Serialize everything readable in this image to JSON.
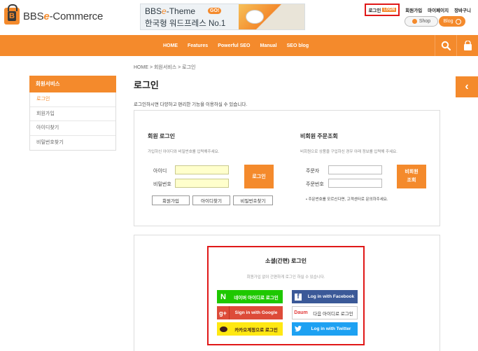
{
  "logo": {
    "text_prefix": "BBS",
    "text_accent": "e",
    "text_suffix": "-Commerce",
    "badge": "B"
  },
  "banner": {
    "line1_prefix": "BBS",
    "line1_accent": "e",
    "line1_suffix": "-Theme",
    "go_badge": "GO!",
    "line2": "한국형 워드프레스 No.1"
  },
  "top_links": [
    {
      "label": "로그인"
    },
    {
      "label": "회원가입"
    },
    {
      "label": "마이페이지"
    },
    {
      "label": "장바구니"
    }
  ],
  "login_tag": "LOGIN",
  "shop_button": "Shop",
  "blog_button": "Blog",
  "nav": {
    "items": [
      "HOME",
      "Features",
      "Powerful SEO",
      "Manual",
      "SEO blog"
    ]
  },
  "sidebar": {
    "title": "회원서비스",
    "items": [
      {
        "label": "로그인",
        "active": true
      },
      {
        "label": "회원가입",
        "active": false
      },
      {
        "label": "아이디찾기",
        "active": false
      },
      {
        "label": "비밀번호찾기",
        "active": false
      }
    ]
  },
  "breadcrumb": "HOME  >  회원서비스  >  로그인",
  "page_title": "로그인",
  "page_desc": "로그인하시면 다양하고 편리한 기능을 이용하실 수 있습니다.",
  "member_login": {
    "title": "회원 로그인",
    "desc": "가입하신 아이디와 비밀번호를 입력해주세요.",
    "id_label": "아이디",
    "pw_label": "비밀번호",
    "id_value": "",
    "pw_value": "",
    "login_button": "로그인",
    "join_button": "회원가입",
    "find_id_button": "아이디찾기",
    "find_pw_button": "비밀번호찾기"
  },
  "guest_order": {
    "title": "비회원 주문조회",
    "desc": "비회원으로 상품을 구입하신 경우 아래 정보를 입력해 주세요.",
    "orderer_label": "주문자",
    "order_no_label": "주문번호",
    "lookup_button_line1": "비회원",
    "lookup_button_line2": "조회",
    "note": "주문번호를 모르신다면, 고객센터로 문의하주세요."
  },
  "social": {
    "title": "소셜(간편) 로그인",
    "desc": "회원가입 없이 간편하게 로그인 하실 수 있습니다.",
    "buttons": [
      {
        "label": "네이버 아이디로 로그인",
        "icon": "N",
        "color": "#1ec800"
      },
      {
        "label": "Log in with Facebook",
        "icon": "f",
        "color": "#3b5998"
      },
      {
        "label": "Sign in with Google",
        "icon": "g+",
        "color": "#dd4b39"
      },
      {
        "label": "다음 아이디로 로그인",
        "icon": "Daum",
        "color": "#ffffff"
      },
      {
        "label": "카카오계정으로 로그인",
        "icon": "talk",
        "color": "#ffe812"
      },
      {
        "label": "Log in with Twitter",
        "icon": "bird",
        "color": "#1da1f2"
      }
    ]
  },
  "colors": {
    "accent": "#f48a2c",
    "highlight_border": "#e01818"
  }
}
